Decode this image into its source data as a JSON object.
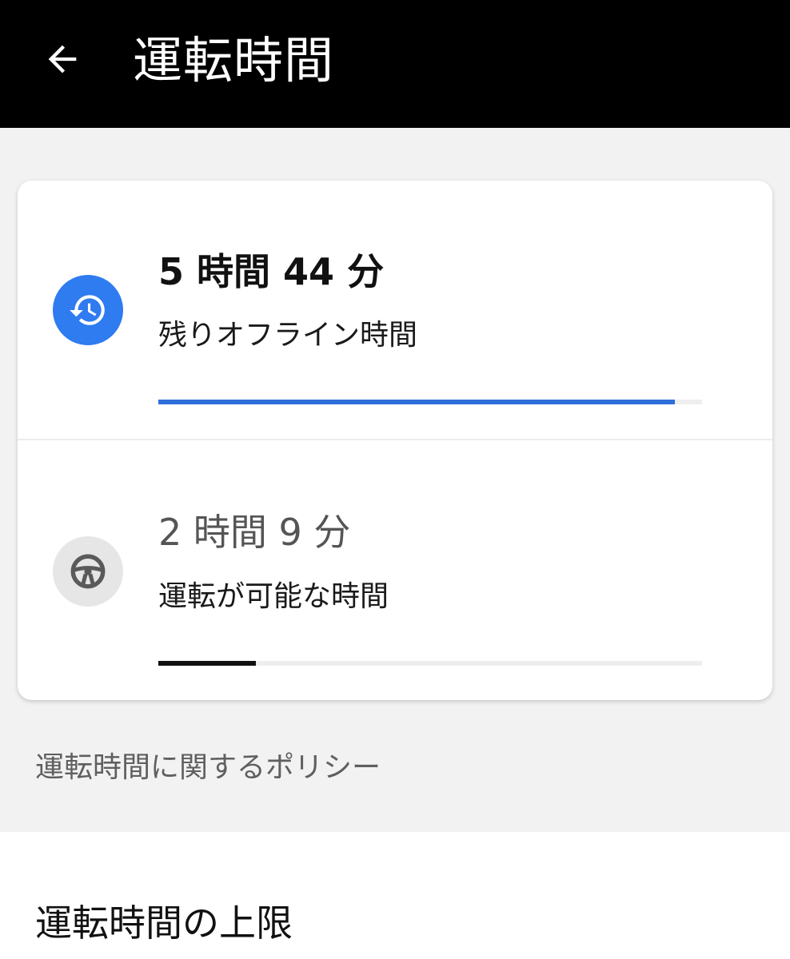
{
  "header": {
    "back_icon": "arrow-back-icon",
    "title": "運転時間"
  },
  "offline_time": {
    "icon": "history-icon",
    "icon_color": "#2f7bf0",
    "value": "5 時間 44 分",
    "label": "残りオフライン時間",
    "progress_fraction": 0.95,
    "progress_color": "#2f6fd9"
  },
  "driving_time": {
    "icon": "steering-wheel-icon",
    "value": "2 時間 9 分",
    "label": "運転が可能な時間",
    "progress_fraction": 0.18,
    "progress_color": "#111111"
  },
  "policy_section": {
    "header": "運転時間に関するポリシー",
    "items": [
      {
        "title": "運転時間の上限"
      }
    ]
  }
}
